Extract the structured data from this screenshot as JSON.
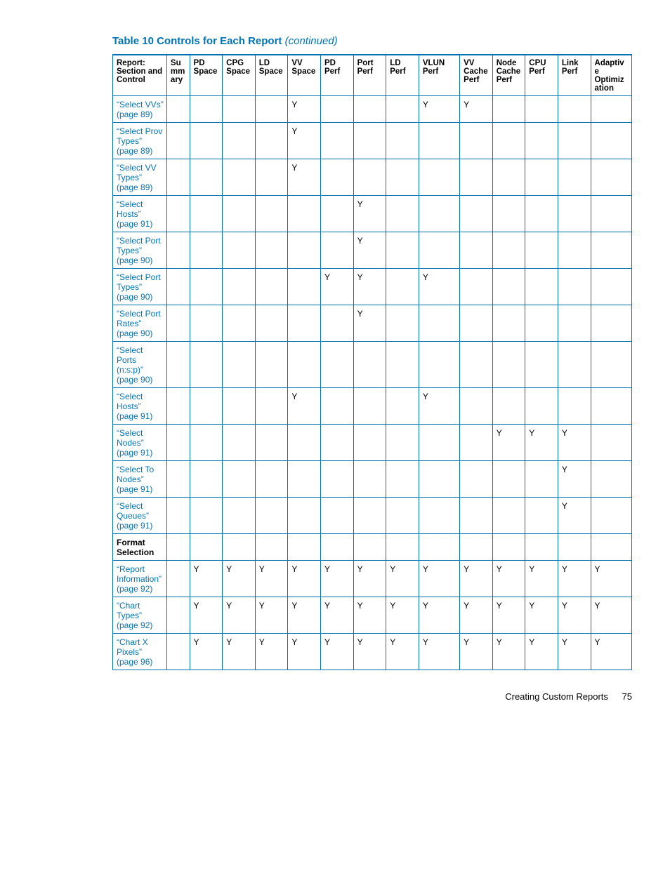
{
  "title": {
    "main": "Table 10 Controls for Each Report",
    "continued": "(continued)"
  },
  "columns": [
    "Report: Section and Control",
    "Summary",
    "PD Space",
    "CPG Space",
    "LD Space",
    "VV Space",
    "PD Perf",
    "Port Perf",
    "LD Perf",
    "VLUN Perf",
    "VV Cache Perf",
    "Node Cache Perf",
    "CPU Perf",
    "Link Perf",
    "Adaptive Optimization"
  ],
  "rows": [
    {
      "label": "“Select VVs” (page 89)",
      "vals": [
        "",
        "",
        "",
        "",
        "Y",
        "",
        "",
        "",
        "Y",
        "Y",
        "",
        "",
        "",
        ""
      ],
      "section": false
    },
    {
      "label": "“Select Prov Types” (page 89)",
      "vals": [
        "",
        "",
        "",
        "",
        "Y",
        "",
        "",
        "",
        "",
        "",
        "",
        "",
        "",
        ""
      ],
      "section": false
    },
    {
      "label": "“Select VV Types” (page 89)",
      "vals": [
        "",
        "",
        "",
        "",
        "Y",
        "",
        "",
        "",
        "",
        "",
        "",
        "",
        "",
        ""
      ],
      "section": false
    },
    {
      "label": "“Select Hosts” (page 91)",
      "vals": [
        "",
        "",
        "",
        "",
        "",
        "",
        "Y",
        "",
        "",
        "",
        "",
        "",
        "",
        ""
      ],
      "section": false
    },
    {
      "label": "“Select Port Types” (page 90)",
      "vals": [
        "",
        "",
        "",
        "",
        "",
        "",
        "Y",
        "",
        "",
        "",
        "",
        "",
        "",
        ""
      ],
      "section": false
    },
    {
      "label": "“Select Port Types” (page 90)",
      "vals": [
        "",
        "",
        "",
        "",
        "",
        "Y",
        "Y",
        "",
        "Y",
        "",
        "",
        "",
        "",
        ""
      ],
      "section": false
    },
    {
      "label": "“Select Port Rates” (page 90)",
      "vals": [
        "",
        "",
        "",
        "",
        "",
        "",
        "Y",
        "",
        "",
        "",
        "",
        "",
        "",
        ""
      ],
      "section": false
    },
    {
      "label": "“Select Ports (n:s:p)” (page 90)",
      "vals": [
        "",
        "",
        "",
        "",
        "",
        "",
        "",
        "",
        "",
        "",
        "",
        "",
        "",
        ""
      ],
      "section": false
    },
    {
      "label": "“Select Hosts” (page 91)",
      "vals": [
        "",
        "",
        "",
        "",
        "Y",
        "",
        "",
        "",
        "Y",
        "",
        "",
        "",
        "",
        ""
      ],
      "section": false
    },
    {
      "label": "“Select Nodes” (page 91)",
      "vals": [
        "",
        "",
        "",
        "",
        "",
        "",
        "",
        "",
        "",
        "",
        "Y",
        "Y",
        "Y",
        ""
      ],
      "section": false
    },
    {
      "label": "“Select To Nodes” (page 91)",
      "vals": [
        "",
        "",
        "",
        "",
        "",
        "",
        "",
        "",
        "",
        "",
        "",
        "",
        "Y",
        ""
      ],
      "section": false
    },
    {
      "label": "“Select Queues” (page 91)",
      "vals": [
        "",
        "",
        "",
        "",
        "",
        "",
        "",
        "",
        "",
        "",
        "",
        "",
        "Y",
        ""
      ],
      "section": false
    },
    {
      "label": "Format Selection",
      "vals": [
        "",
        "",
        "",
        "",
        "",
        "",
        "",
        "",
        "",
        "",
        "",
        "",
        "",
        ""
      ],
      "section": true
    },
    {
      "label": "“Report Information” (page 92)",
      "vals": [
        "",
        "Y",
        "Y",
        "Y",
        "Y",
        "Y",
        "Y",
        "Y",
        "Y",
        "Y",
        "Y",
        "Y",
        "Y",
        "Y"
      ],
      "section": false
    },
    {
      "label": "“Chart Types” (page 92)",
      "vals": [
        "",
        "Y",
        "Y",
        "Y",
        "Y",
        "Y",
        "Y",
        "Y",
        "Y",
        "Y",
        "Y",
        "Y",
        "Y",
        "Y"
      ],
      "section": false
    },
    {
      "label": "“Chart X Pixels” (page 96)",
      "vals": [
        "",
        "Y",
        "Y",
        "Y",
        "Y",
        "Y",
        "Y",
        "Y",
        "Y",
        "Y",
        "Y",
        "Y",
        "Y",
        "Y"
      ],
      "section": false
    }
  ],
  "footer": {
    "text": "Creating Custom Reports",
    "page": "75"
  }
}
